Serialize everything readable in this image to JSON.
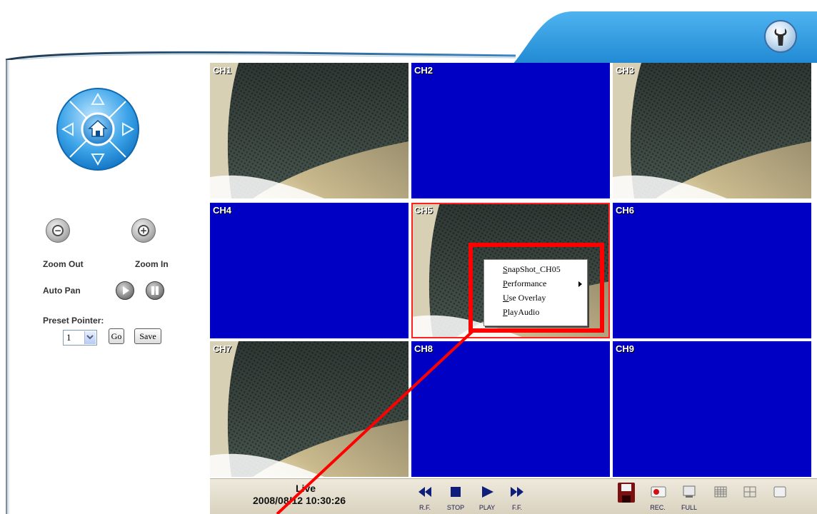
{
  "colors": {
    "header_blue": "#1e8ed8",
    "channel_no_signal": "#0000c4",
    "selection_red": "#ff0000",
    "bottom_bar": "#e6e0d0"
  },
  "header": {
    "tool_icon": "wrench-icon"
  },
  "left_panel": {
    "ptz": {
      "icon_center": "home-icon",
      "icon_up": "arrow-up-icon",
      "icon_down": "arrow-down-icon",
      "icon_left": "arrow-left-icon",
      "icon_right": "arrow-right-icon"
    },
    "zoom_out_label": "Zoom Out",
    "zoom_in_label": "Zoom In",
    "auto_pan_label": "Auto Pan",
    "preset_label": "Preset Pointer:",
    "preset_value": "1",
    "go_label": "Go",
    "save_label": "Save"
  },
  "channels": [
    {
      "name": "CH1",
      "signal": true
    },
    {
      "name": "CH2",
      "signal": false
    },
    {
      "name": "CH3",
      "signal": true
    },
    {
      "name": "CH4",
      "signal": false
    },
    {
      "name": "CH5",
      "signal": true,
      "selected": true
    },
    {
      "name": "CH6",
      "signal": false
    },
    {
      "name": "CH7",
      "signal": true
    },
    {
      "name": "CH8",
      "signal": false
    },
    {
      "name": "CH9",
      "signal": false
    }
  ],
  "context_menu": {
    "items": [
      {
        "first": "S",
        "rest": "napShot_CH05"
      },
      {
        "first": "P",
        "rest": "erformance",
        "submenu": true
      },
      {
        "first": "U",
        "rest": "se Overlay"
      },
      {
        "first": "P",
        "rest": "layAudio"
      }
    ]
  },
  "status": {
    "mode": "Live",
    "datetime": "2008/08/12 10:30:26"
  },
  "playback": {
    "rf_label": "R.F.",
    "stop_label": "STOP",
    "play_label": "PLAY",
    "ff_label": "F.F."
  },
  "toolbar": {
    "save_icon": "floppy-disk-icon",
    "rec_label": "REC.",
    "full_label": "FULL"
  }
}
